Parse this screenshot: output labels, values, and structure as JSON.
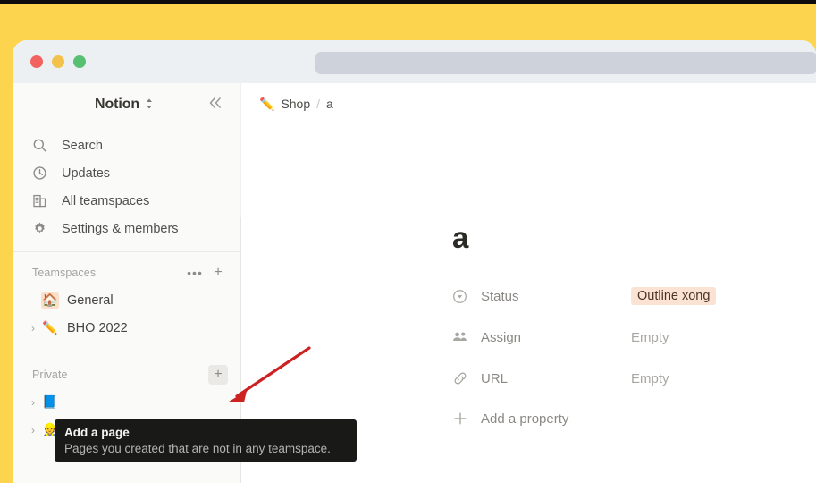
{
  "browser": {
    "traffic_lights": [
      "close-red",
      "minimize-yellow",
      "maximize-green"
    ],
    "url_bar_value": "",
    "url_bar_placeholder": ""
  },
  "sidebar": {
    "workspace_name": "Notion",
    "workspace_switcher_icon": "chevron-up-down-icon",
    "collapse_icon": "chevron-double-left-icon",
    "nav_items": [
      {
        "label": "Search",
        "icon": "search-icon"
      },
      {
        "label": "Updates",
        "icon": "clock-icon"
      },
      {
        "label": "All teamspaces",
        "icon": "building-icon"
      },
      {
        "label": "Settings & members",
        "icon": "gear-icon"
      }
    ],
    "teamspaces": {
      "title": "Teamspaces",
      "more_label": "•••",
      "add_label": "+",
      "items": [
        {
          "label": "General",
          "emoji": "🏠",
          "twisty": "",
          "boxed": true
        },
        {
          "label": "BHO 2022",
          "emoji": "✏️",
          "twisty": "›",
          "boxed": false
        }
      ]
    },
    "private": {
      "title": "Private",
      "add_label": "+",
      "items": [
        {
          "label": "",
          "emoji": "📘",
          "twisty": "›"
        },
        {
          "label": "",
          "emoji": "👷",
          "twisty": "›"
        }
      ]
    }
  },
  "main": {
    "breadcrumb": {
      "emoji": "✏️",
      "items": [
        "Shop",
        "a"
      ],
      "separator": "/"
    },
    "page_title": "a",
    "properties": [
      {
        "name": "Status",
        "icon": "circle-chevron-down-icon",
        "value": "Outline xong",
        "is_badge": true
      },
      {
        "name": "Assign",
        "icon": "people-icon",
        "value": "Empty",
        "is_badge": false
      },
      {
        "name": "URL",
        "icon": "link-icon",
        "value": "Empty",
        "is_badge": false
      }
    ],
    "add_property_label": "Add a property",
    "add_property_icon": "plus-icon"
  },
  "tooltip": {
    "title": "Add a page",
    "description": "Pages you created that are not in any teamspace."
  },
  "annotation": {
    "type": "arrow",
    "color": "#CC2222",
    "points_to": "private-add-page-button"
  },
  "colors": {
    "desktop_yellow": "#FCD44D",
    "browser_chrome": "#EDF0F3",
    "url_bar": "#CDD2DB",
    "sidebar_bg": "#FAFAF9",
    "tooltip_bg": "#191918",
    "status_badge_bg": "#FAE3D2",
    "status_badge_text": "#4C3326",
    "annotation_red": "#CC2222"
  }
}
